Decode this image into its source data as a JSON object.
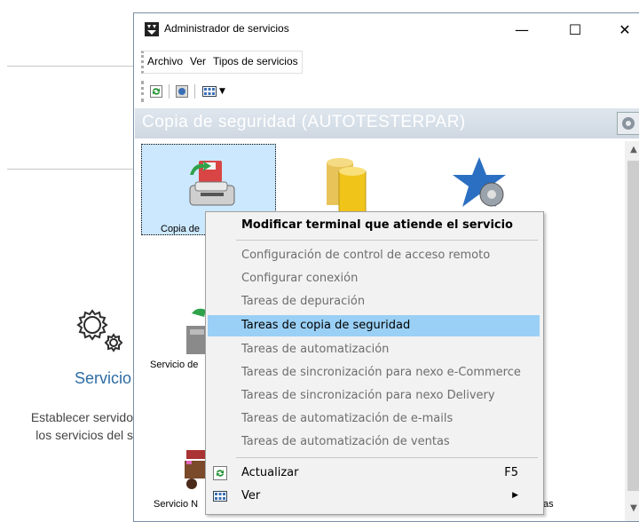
{
  "background": {
    "title": "Servicio",
    "desc_line1": "Establecer servido",
    "desc_line2": "los servicios del s"
  },
  "window": {
    "title": "Administrador de servicios",
    "minimize": "—",
    "maximize": "☐",
    "close": "✕"
  },
  "menu": [
    {
      "label": "Archivo"
    },
    {
      "label": "Ver"
    },
    {
      "label": "Tipos de servicios"
    }
  ],
  "header": {
    "text": "Copia de seguridad (AUTOTESTERPAR)"
  },
  "services": [
    {
      "label": "Copia de"
    },
    {
      "label": "Servicio de"
    },
    {
      "label": "Servicio N"
    },
    {
      "label": "as"
    }
  ],
  "context_menu": {
    "items": [
      {
        "label": "Modificar terminal que atiende el servicio",
        "style": "bold"
      },
      {
        "label": "Configuración de control de acceso remoto",
        "style": "dim"
      },
      {
        "label": "Configurar conexión",
        "style": "dim"
      },
      {
        "label": "Tareas de depuración",
        "style": "dim"
      },
      {
        "label": "Tareas de copia de seguridad",
        "style": "highlighted"
      },
      {
        "label": "Tareas de automatización",
        "style": "dim"
      },
      {
        "label": "Tareas de sincronización para nexo e-Commerce",
        "style": "dim"
      },
      {
        "label": "Tareas de sincronización para nexo Delivery",
        "style": "dim"
      },
      {
        "label": "Tareas de automatización de e-mails",
        "style": "dim"
      },
      {
        "label": "Tareas de automatización de ventas",
        "style": "dim"
      },
      {
        "label": "Actualizar",
        "shortcut": "F5",
        "icon": "refresh-icon"
      },
      {
        "label": "Ver",
        "submenu_arrow": "▶",
        "icon": "view-icon"
      }
    ]
  },
  "colors": {
    "highlight": "#9ad0f5",
    "selection": "#cce8ff",
    "header_band": "#d4dde7",
    "accent_text": "#2e6ca4"
  }
}
